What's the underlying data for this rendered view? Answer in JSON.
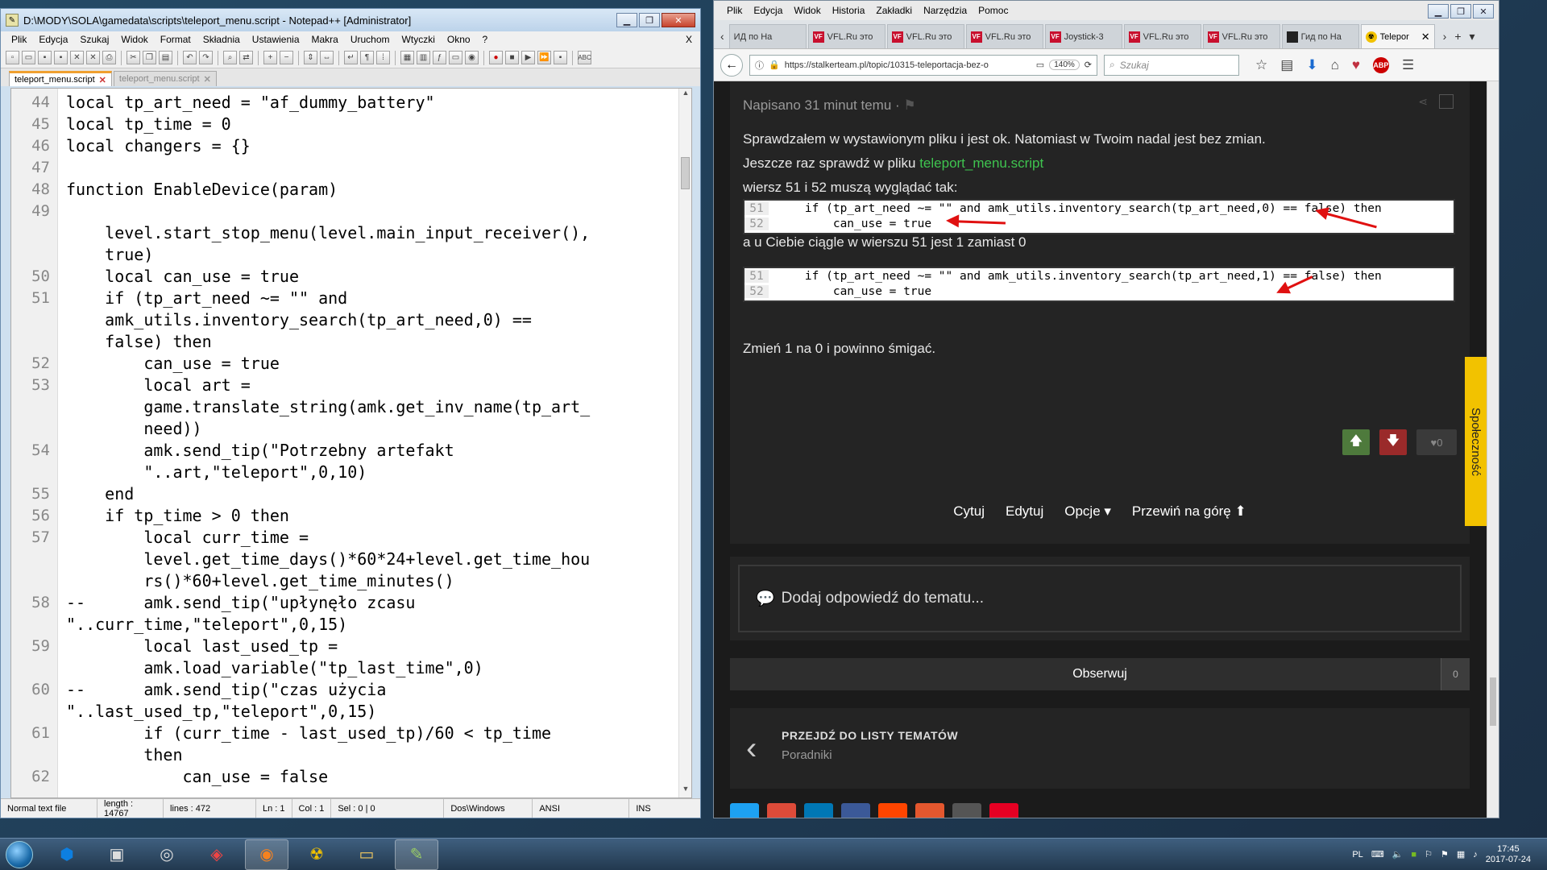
{
  "notepad": {
    "title": "D:\\MODY\\SOLA\\gamedata\\scripts\\teleport_menu.script - Notepad++ [Administrator]",
    "menu": [
      "Plik",
      "Edycja",
      "Szukaj",
      "Widok",
      "Format",
      "Składnia",
      "Ustawienia",
      "Makra",
      "Uruchom",
      "Wtyczki",
      "Okno",
      "?"
    ],
    "menu_close": "X",
    "tabs": [
      {
        "label": "teleport_menu.script",
        "active": true
      },
      {
        "label": "teleport_menu.script",
        "active": false
      }
    ],
    "lines": [
      {
        "n": "44",
        "t": "local tp_art_need = \"af_dummy_battery\""
      },
      {
        "n": "45",
        "t": "local tp_time = 0"
      },
      {
        "n": "46",
        "t": "local changers = {}"
      },
      {
        "n": "47",
        "t": ""
      },
      {
        "n": "48",
        "t": "function EnableDevice(param)"
      },
      {
        "n": "49",
        "t": ""
      },
      {
        "n": "",
        "t": "    level.start_stop_menu(level.main_input_receiver(),"
      },
      {
        "n": "",
        "t": "    true)"
      },
      {
        "n": "50",
        "t": "    local can_use = true"
      },
      {
        "n": "51",
        "t": "    if (tp_art_need ~= \"\" and"
      },
      {
        "n": "",
        "t": "    amk_utils.inventory_search(tp_art_need,0) =="
      },
      {
        "n": "",
        "t": "    false) then"
      },
      {
        "n": "52",
        "t": "        can_use = true"
      },
      {
        "n": "53",
        "t": "        local art ="
      },
      {
        "n": "",
        "t": "        game.translate_string(amk.get_inv_name(tp_art_"
      },
      {
        "n": "",
        "t": "        need))"
      },
      {
        "n": "54",
        "t": "        amk.send_tip(\"Potrzebny artefakt"
      },
      {
        "n": "",
        "t": "        \"..art,\"teleport\",0,10)"
      },
      {
        "n": "55",
        "t": "    end"
      },
      {
        "n": "56",
        "t": "    if tp_time > 0 then"
      },
      {
        "n": "57",
        "t": "        local curr_time ="
      },
      {
        "n": "",
        "t": "        level.get_time_days()*60*24+level.get_time_hou"
      },
      {
        "n": "",
        "t": "        rs()*60+level.get_time_minutes()"
      },
      {
        "n": "58",
        "t": "--      amk.send_tip(\"upłynęło zcasu"
      },
      {
        "n": "",
        "t": "\"..curr_time,\"teleport\",0,15)"
      },
      {
        "n": "59",
        "t": "        local last_used_tp ="
      },
      {
        "n": "",
        "t": "        amk.load_variable(\"tp_last_time\",0)"
      },
      {
        "n": "60",
        "t": "--      amk.send_tip(\"czas użycia"
      },
      {
        "n": "",
        "t": "\"..last_used_tp,\"teleport\",0,15)"
      },
      {
        "n": "61",
        "t": "        if (curr_time - last_used_tp)/60 < tp_time"
      },
      {
        "n": "",
        "t": "        then"
      },
      {
        "n": "62",
        "t": "            can_use = false"
      }
    ],
    "status": {
      "type": "Normal text file",
      "length": "length : 14767",
      "lines": "lines : 472",
      "ln": "Ln : 1",
      "col": "Col : 1",
      "sel": "Sel : 0 | 0",
      "eol": "Dos\\Windows",
      "enc": "ANSI",
      "mode": "INS"
    }
  },
  "firefox": {
    "menu": [
      "Plik",
      "Edycja",
      "Widok",
      "Historia",
      "Zakładki",
      "Narzędzia",
      "Pomoc"
    ],
    "tabs": [
      {
        "label": "ИД по Ha",
        "fav": "",
        "active": false
      },
      {
        "label": "VFL.Ru это",
        "fav": "VF",
        "active": false
      },
      {
        "label": "VFL.Ru это",
        "fav": "VF",
        "active": false
      },
      {
        "label": "VFL.Ru это",
        "fav": "VF",
        "active": false
      },
      {
        "label": "Joystick-3",
        "fav": "VF",
        "active": false
      },
      {
        "label": "VFL.Ru это",
        "fav": "VF",
        "active": false
      },
      {
        "label": "VFL.Ru это",
        "fav": "VF",
        "active": false
      },
      {
        "label": "Гид по Ha",
        "fav": "",
        "active": false
      },
      {
        "label": "Telepor",
        "fav": "",
        "active": true
      }
    ],
    "url": "https://stalkerteam.pl/topic/10315-teleportacja-bez-o",
    "zoom": "140%",
    "search_placeholder": "Szukaj"
  },
  "post": {
    "header": "Napisano 31 minut temu ·",
    "p1": "Sprawdzałem w wystawionym pliku i jest ok. Natomiast w Twoim nadal jest bez zmian.",
    "p2_prefix": "Jeszcze raz sprawdź w pliku",
    "p2_link": "teleport_menu.script",
    "p3": "wiersz 51 i 52 muszą wyglądać tak:",
    "code1": [
      {
        "n": "51",
        "c": "    if (tp_art_need ~= \"\" and amk_utils.inventory_search(tp_art_need,0) == false) then"
      },
      {
        "n": "52",
        "c": "        can_use = true"
      }
    ],
    "p4": "a u Ciebie ciągle w wierszu 51 jest 1 zamiast 0",
    "code2": [
      {
        "n": "51",
        "c": "    if (tp_art_need ~= \"\" and amk_utils.inventory_search(tp_art_need,1) == false) then"
      },
      {
        "n": "52",
        "c": "        can_use = true"
      }
    ],
    "p5": "Zmień 1 na 0 i powinno śmigać.",
    "vote_count": "0",
    "actions": [
      "Cytuj",
      "Edytuj",
      "Opcje ▾",
      "Przewiń na górę ⬆"
    ],
    "side_tab": "Społeczność"
  },
  "reply_placeholder": "Dodaj odpowiedź do tematu...",
  "follow": {
    "label": "Obserwuj",
    "count": "0"
  },
  "back": {
    "title": "PRZEJDŹ DO LISTY TEMATÓW",
    "sub": "Poradniki"
  },
  "taskbar": {
    "lang": "PL",
    "time": "17:45",
    "date": "2017-07-24"
  },
  "colors": {
    "link": "#3fc44f",
    "vote_up": "#4e7a3c",
    "vote_down": "#9a2a2a",
    "side_tab": "#f2c200",
    "arrow": "#e01010"
  }
}
